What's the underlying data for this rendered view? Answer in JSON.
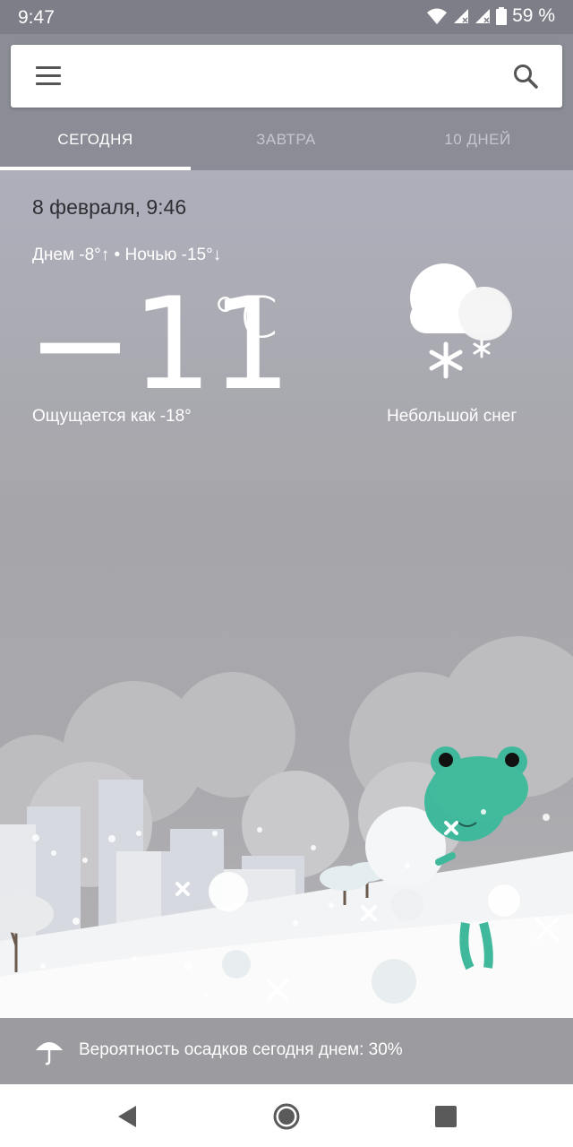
{
  "status_bar": {
    "time": "9:47",
    "battery": "59 %",
    "icons": [
      "wifi-icon",
      "signal-icon",
      "signal-icon",
      "battery-icon"
    ]
  },
  "search": {
    "placeholder": "",
    "menu_icon": "menu-icon",
    "search_icon": "search-icon"
  },
  "tabs": [
    {
      "label": "СЕГОДНЯ",
      "active": true
    },
    {
      "label": "ЗАВТРА",
      "active": false
    },
    {
      "label": "10 ДНЕЙ",
      "active": false
    }
  ],
  "weather": {
    "date_time": "8 февраля, 9:46",
    "day_night": "Днем -8°↑ • Ночью -15°↓",
    "temperature": "−11",
    "unit": "°C",
    "feels_like": "Ощущается как -18°",
    "condition": "Небольшой снег",
    "condition_icon": "snow-cloud-icon"
  },
  "precipitation": {
    "text": "Вероятность осадков сегодня днем: 30%",
    "icon": "umbrella-icon"
  },
  "navigation": {
    "icons": [
      "back-icon",
      "home-icon",
      "recents-icon"
    ]
  },
  "colors": {
    "header": "#8b8c95",
    "status_bar": "#7d7e87",
    "accent_frog": "#3fb89b"
  }
}
